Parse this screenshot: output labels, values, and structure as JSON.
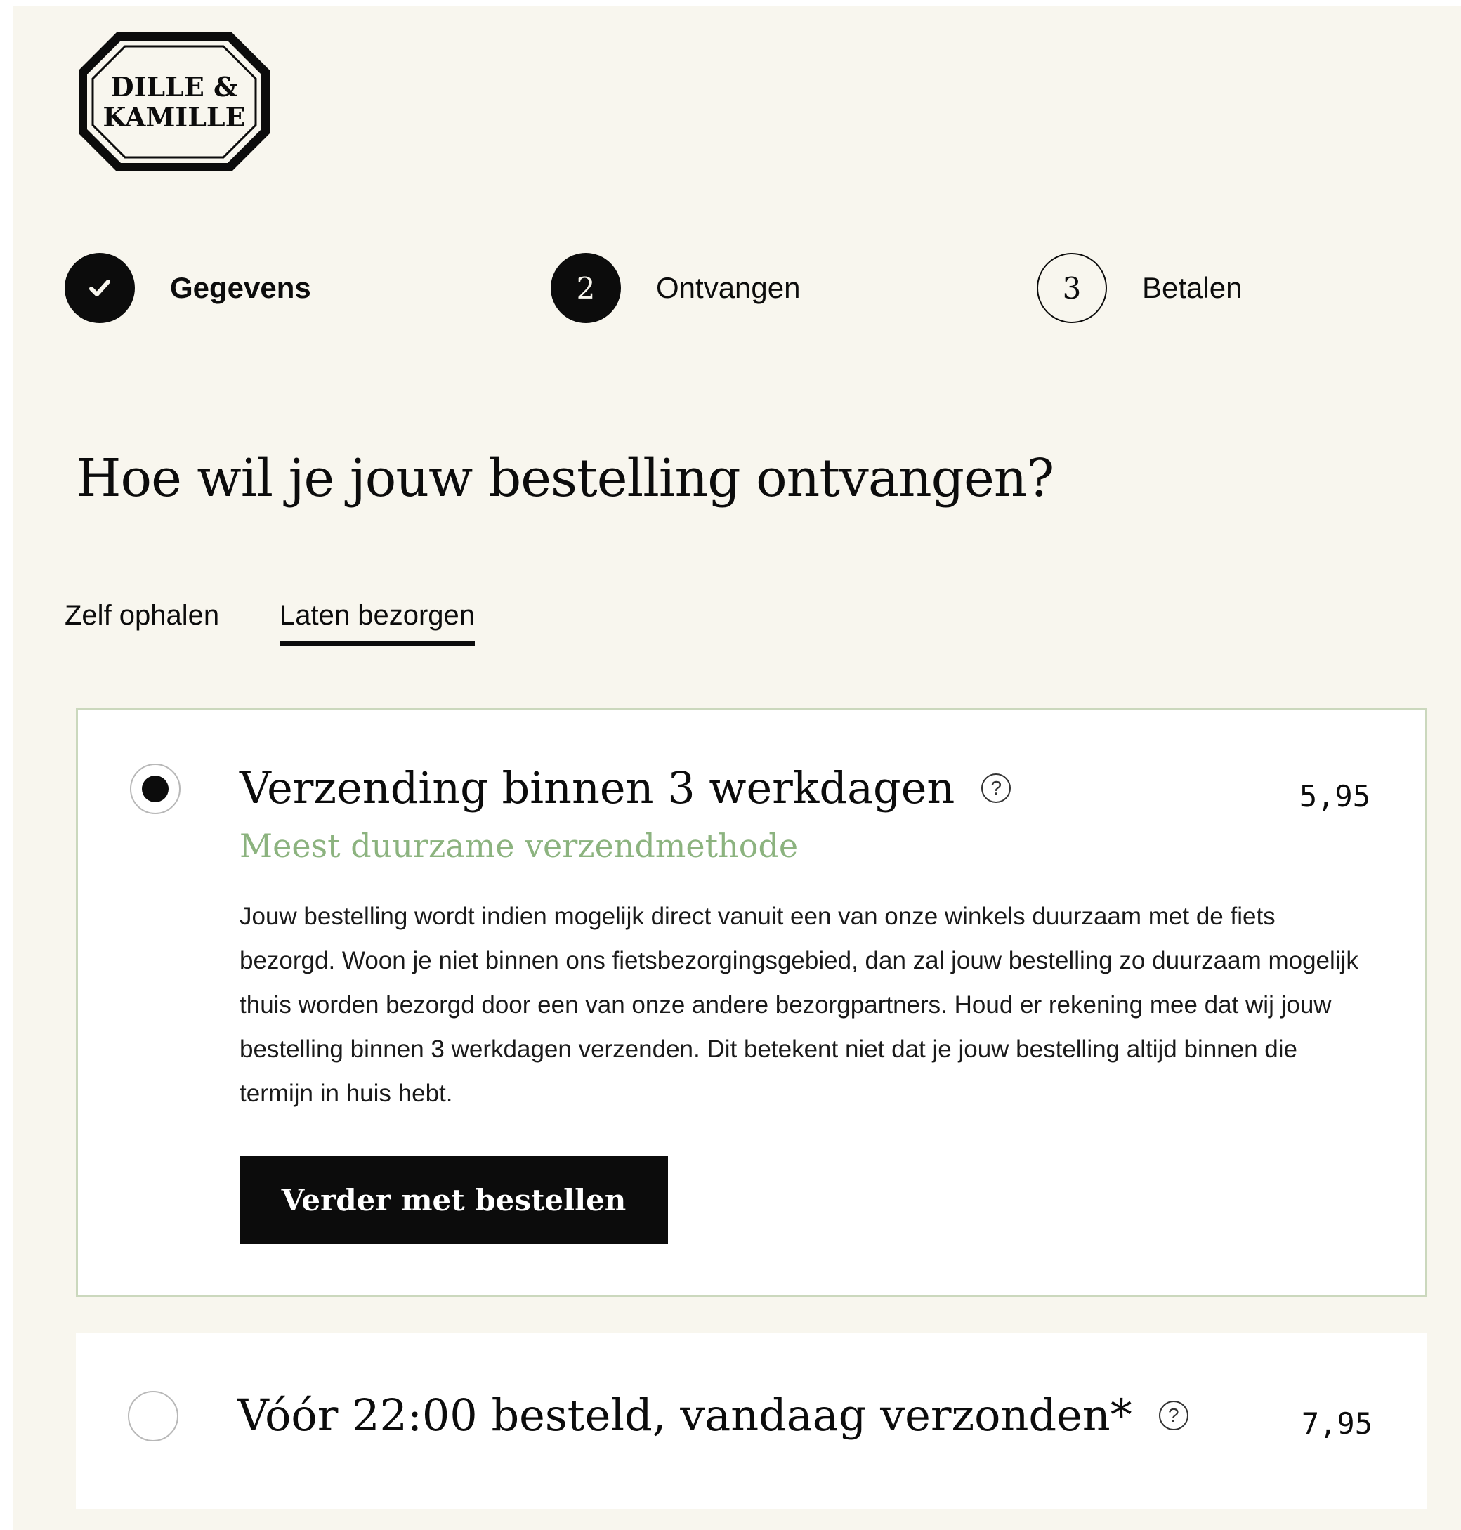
{
  "brand": {
    "logo_text_line1": "DILLE &",
    "logo_text_line2": "KAMILLE"
  },
  "steps": [
    {
      "label": "Gegevens",
      "state": "completed",
      "icon": "check-icon"
    },
    {
      "number": "2",
      "label": "Ontvangen",
      "state": "current"
    },
    {
      "number": "3",
      "label": "Betalen",
      "state": "upcoming"
    }
  ],
  "heading": "Hoe wil je jouw bestelling ontvangen?",
  "tabs": [
    {
      "label": "Zelf ophalen",
      "active": false
    },
    {
      "label": "Laten bezorgen",
      "active": true
    }
  ],
  "options": [
    {
      "title": "Verzending binnen 3 werkdagen",
      "price": "5,95",
      "selected": true,
      "subtitle": "Meest duurzame verzendmethode",
      "description": "Jouw bestelling wordt indien mogelijk direct vanuit een van onze winkels duurzaam met de fiets bezorgd. Woon je niet binnen ons fietsbezorgingsgebied, dan zal jouw bestelling zo duurzaam mogelijk thuis worden bezorgd door een van onze andere bezorgpartners. Houd er rekening mee dat wij jouw bestelling binnen 3 werkdagen verzenden. Dit betekent niet dat je jouw bestelling altijd binnen die termijn in huis hebt.",
      "button_label": "Verder met bestellen"
    },
    {
      "title": "Vóór 22:00 besteld, vandaag verzonden*",
      "price": "7,95",
      "selected": false
    }
  ],
  "colors": {
    "background": "#f8f6ee",
    "accent_green": "#8cb37f",
    "selected_border": "#cbd8bd",
    "ink": "#0c0c0c"
  }
}
